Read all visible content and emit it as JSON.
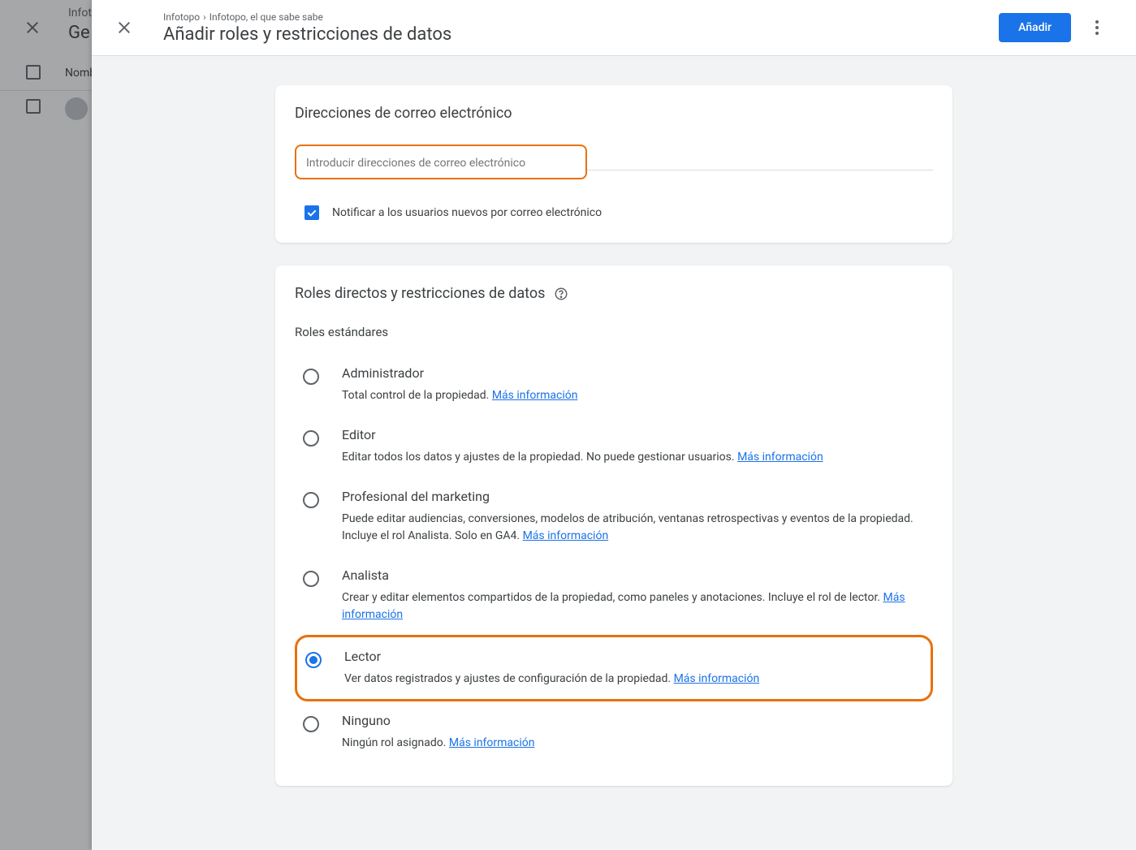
{
  "backdrop": {
    "title_small": "Infot",
    "title_large": "Ge",
    "col_label": "Nomb"
  },
  "header": {
    "breadcrumb_root": "Infotopo",
    "breadcrumb_leaf": "Infotopo, el que sabe sabe",
    "heading": "Añadir roles y restricciones de datos",
    "add_button": "Añadir"
  },
  "email_card": {
    "title": "Direcciones de correo electrónico",
    "placeholder": "Introducir direcciones de correo electrónico",
    "notify_label": "Notificar a los usuarios nuevos por correo electrónico",
    "notify_checked": true
  },
  "roles_card": {
    "title": "Roles directos y restricciones de datos",
    "subhead": "Roles estándares",
    "learn_more": "Más información",
    "roles": [
      {
        "id": "admin",
        "name": "Administrador",
        "desc": "Total control de la propiedad.",
        "selected": false
      },
      {
        "id": "editor",
        "name": "Editor",
        "desc": "Editar todos los datos y ajustes de la propiedad. No puede gestionar usuarios.",
        "selected": false
      },
      {
        "id": "marketer",
        "name": "Profesional del marketing",
        "desc": "Puede editar audiencias, conversiones, modelos de atribución, ventanas retrospectivas y eventos de la propiedad. Incluye el rol Analista. Solo en GA4.",
        "selected": false
      },
      {
        "id": "analyst",
        "name": "Analista",
        "desc": "Crear y editar elementos compartidos de la propiedad, como paneles y anotaciones. Incluye el rol de lector.",
        "selected": false
      },
      {
        "id": "viewer",
        "name": "Lector",
        "desc": "Ver datos registrados y ajustes de configuración de la propiedad.",
        "selected": true
      },
      {
        "id": "none",
        "name": "Ninguno",
        "desc": "Ningún rol asignado.",
        "selected": false
      }
    ]
  }
}
